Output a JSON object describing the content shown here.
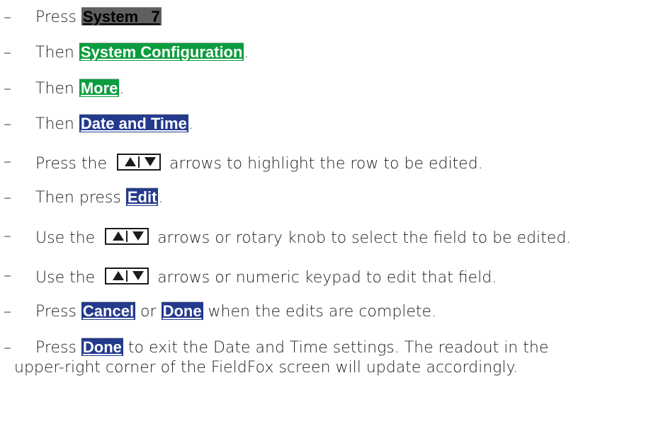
{
  "dash": "–",
  "steps": [
    {
      "pre": "Press ",
      "key": "System   7",
      "post": ""
    },
    {
      "pre": "Then ",
      "key": "System Configuration",
      "post": "."
    },
    {
      "pre": "Then ",
      "key": "More",
      "post": "."
    },
    {
      "pre": "Then ",
      "key": "Date and Time",
      "post": "."
    },
    {
      "pre": "Press the",
      "post": "arrows to highlight the row to be edited."
    },
    {
      "pre": "Then press ",
      "key": "Edit",
      "post": "."
    },
    {
      "pre": "Use the",
      "post": "arrows or rotary knob to select the field to be edited."
    },
    {
      "pre": "Use the",
      "post": "arrows or numeric keypad to edit that field."
    },
    {
      "pre": "Press ",
      "key": "Cancel",
      "mid": " or ",
      "key2": "Done",
      "post": " when the edits are complete."
    },
    {
      "pre": "Press ",
      "key": "Done",
      "post": " to exit the Date and Time settings. The readout in the",
      "line2": "upper-right corner of the FieldFox screen will update accordingly."
    }
  ],
  "colors": {
    "hardkey": "#5f5f5f",
    "softkey_green": "#0b9d3e",
    "softkey_blue": "#233a8d"
  },
  "icons": {
    "arrow_keys": "up-down-arrow-keys-icon"
  }
}
